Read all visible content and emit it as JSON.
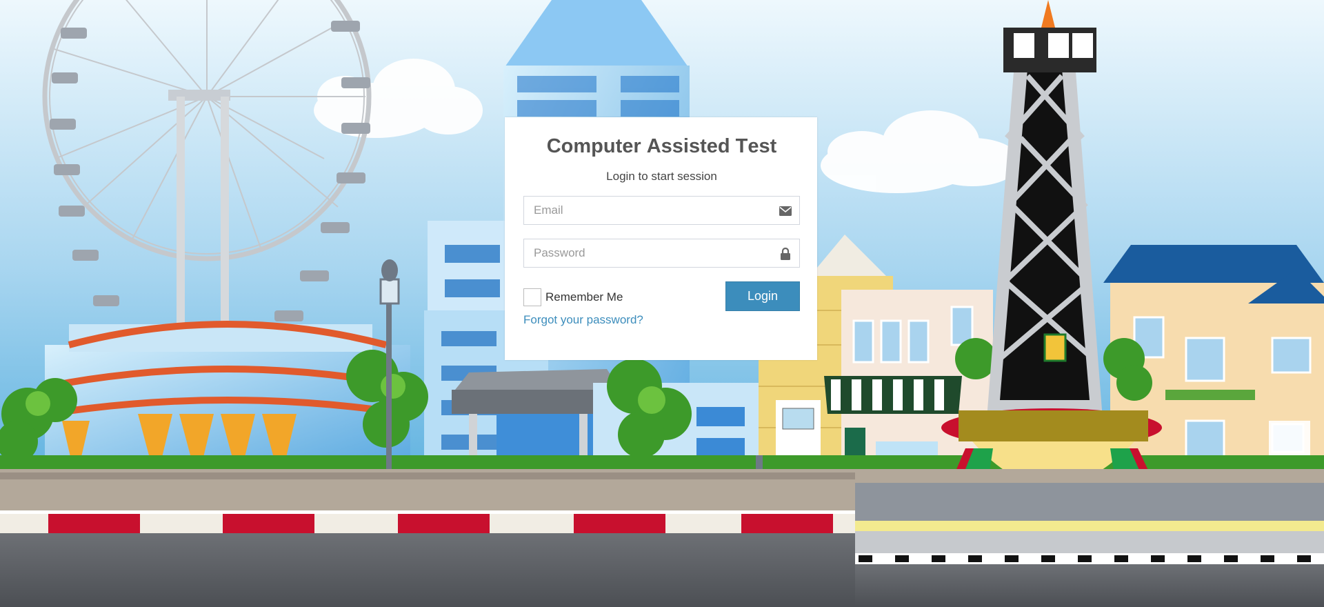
{
  "login": {
    "title_parts": [
      {
        "text": "C",
        "bold": true
      },
      {
        "text": "omputer ",
        "bold": false
      },
      {
        "text": "A",
        "bold": true
      },
      {
        "text": "ssisted ",
        "bold": false
      },
      {
        "text": "T",
        "bold": true
      },
      {
        "text": "est",
        "bold": false
      }
    ],
    "subtitle": "Login to start session",
    "email_placeholder": "Email",
    "password_placeholder": "Password",
    "remember_label": "Remember Me",
    "login_button": "Login",
    "forgot_link": "Forgot your password?"
  },
  "icons": {
    "email": "envelope-icon",
    "password": "lock-icon"
  },
  "colors": {
    "accent": "#3c8dbc",
    "stripe_red": "#c8102e",
    "sky": "#8fc7ea"
  }
}
